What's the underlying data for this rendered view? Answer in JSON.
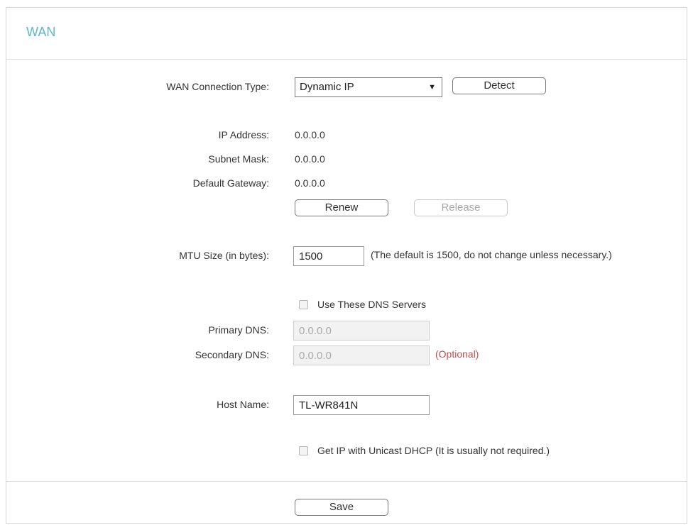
{
  "title": "WAN",
  "connection_type": {
    "label": "WAN Connection Type:",
    "value": "Dynamic IP",
    "detect_label": "Detect"
  },
  "ip_info": {
    "ip_address_label": "IP Address:",
    "ip_address": "0.0.0.0",
    "subnet_mask_label": "Subnet Mask:",
    "subnet_mask": "0.0.0.0",
    "gateway_label": "Default Gateway:",
    "gateway": "0.0.0.0",
    "renew_label": "Renew",
    "release_label": "Release"
  },
  "mtu": {
    "label": "MTU Size (in bytes):",
    "value": "1500",
    "hint": "(The default is 1500, do not change unless necessary.)"
  },
  "dns": {
    "use_servers_label": "Use These DNS Servers",
    "use_servers_checked": false,
    "primary_label": "Primary DNS:",
    "primary_value": "0.0.0.0",
    "secondary_label": "Secondary DNS:",
    "secondary_value": "0.0.0.0",
    "optional_label": "(Optional)"
  },
  "host": {
    "label": "Host Name:",
    "value": "TL-WR841N"
  },
  "unicast": {
    "label": "Get IP with Unicast DHCP (It is usually not required.)",
    "checked": false
  },
  "save_label": "Save",
  "colors": {
    "title": "#5cb6cc",
    "optional": "#c0504d"
  }
}
